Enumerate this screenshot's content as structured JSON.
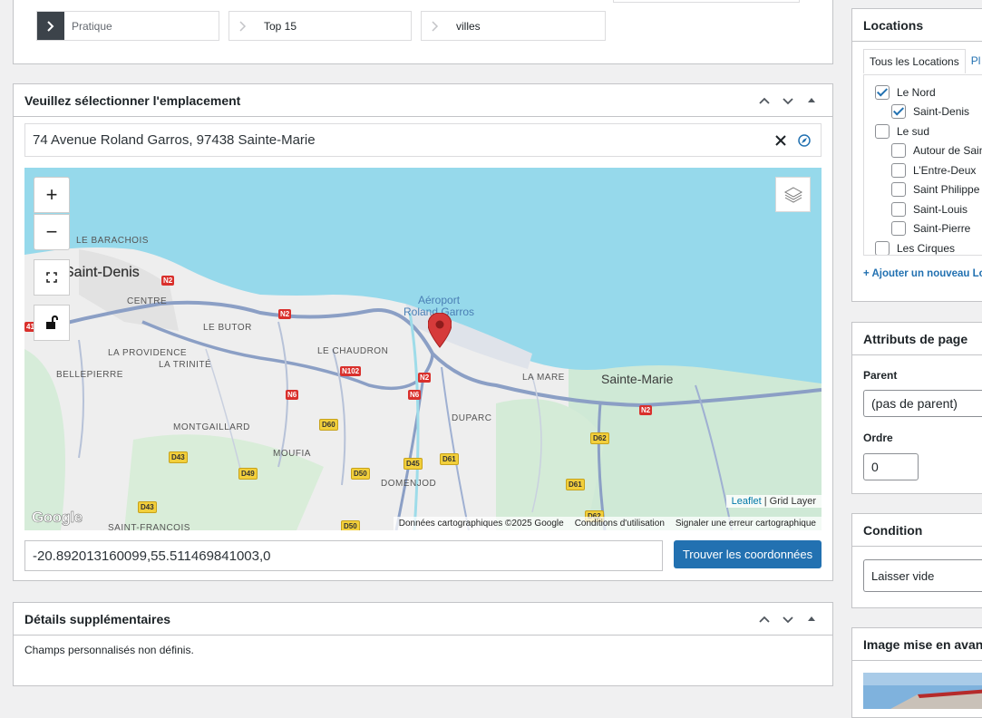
{
  "breadcrumbs": [
    {
      "label": "Pratique"
    },
    {
      "label": "Top 15"
    },
    {
      "label": "villes"
    }
  ],
  "location_box": {
    "title": "Veuillez sélectionner l'emplacement",
    "address": "74 Avenue Roland Garros, 97438 Sainte-Marie",
    "coordinates": "-20.892013160099,55.511469841003,0",
    "find_button": "Trouver les coordonnées"
  },
  "map": {
    "zoom_in": "+",
    "zoom_out": "−",
    "labels": {
      "saint_denis": "Saint-Denis",
      "sainte_marie": "Sainte-Marie",
      "le_barachois": "LE BARACHOIS",
      "centre": "CENTRE",
      "le_butor": "LE BUTOR",
      "la_providence": "LA PROVIDENCE",
      "la_trinite": "LA TRINITÉ",
      "bellepierre": "BELLEPIERRE",
      "le_chaudron": "LE CHAUDRON",
      "montgaillard": "MONTGAILLARD",
      "moufia": "MOUFIA",
      "domenjod": "DOMENJOD",
      "duparc": "DUPARC",
      "la_mare": "LA MARE",
      "saint_francois": "SAINT-FRANÇOIS",
      "airport_line1": "Aéroport",
      "airport_line2": "Roland Garros"
    },
    "roads": {
      "n2_a": "N2",
      "n2_b": "N2",
      "n2_c": "N2",
      "n2_d": "N2",
      "n102": "N102",
      "n6_a": "N6",
      "n6_b": "N6",
      "d60": "D60",
      "d43_a": "D43",
      "d43_b": "D43",
      "d49": "D49",
      "d50_a": "D50",
      "d50_b": "D50",
      "d45": "D45",
      "d61_a": "D61",
      "d61_b": "D61",
      "d62_a": "D62",
      "d62_b": "D62",
      "n41": "41"
    },
    "google_logo": "Google",
    "attribution_leaflet": "Leaflet",
    "attribution_sep": " | ",
    "attribution_layer": "Grid Layer",
    "footer_data": "Données cartographiques ©2025 Google",
    "footer_terms": "Conditions d'utilisation",
    "footer_report": "Signaler une erreur cartographique",
    "colors": {
      "sea": "#96d9eb",
      "land": "#eeeeee",
      "green": "#cde9d3",
      "road": "#8b9fc5",
      "marker": "#d63a3a"
    }
  },
  "details_box": {
    "title": "Détails supplémentaires",
    "message": "Champs personnalisés non définis."
  },
  "sidebar": {
    "locations": {
      "title": "Locations",
      "tabs": [
        "Tous les Locations",
        "Pl"
      ],
      "items": [
        {
          "label": "Le Nord",
          "checked": true,
          "level": 0
        },
        {
          "label": "Saint-Denis",
          "checked": true,
          "level": 1
        },
        {
          "label": "Le sud",
          "checked": false,
          "level": 0
        },
        {
          "label": "Autour de Sain",
          "checked": false,
          "level": 1
        },
        {
          "label": "L’Entre-Deux",
          "checked": false,
          "level": 1
        },
        {
          "label": "Saint Philippe",
          "checked": false,
          "level": 1
        },
        {
          "label": "Saint-Louis",
          "checked": false,
          "level": 1
        },
        {
          "label": "Saint-Pierre",
          "checked": false,
          "level": 1
        },
        {
          "label": "Les Cirques",
          "checked": false,
          "level": 0
        }
      ],
      "add_link": "+ Ajouter un nouveau Lo"
    },
    "page_attributes": {
      "title": "Attributs de page",
      "parent_label": "Parent",
      "parent_value": "(pas de parent)",
      "order_label": "Ordre",
      "order_value": "0"
    },
    "condition": {
      "title": "Condition",
      "value": "Laisser vide"
    },
    "featured_image": {
      "title": "Image mise en avan"
    }
  }
}
